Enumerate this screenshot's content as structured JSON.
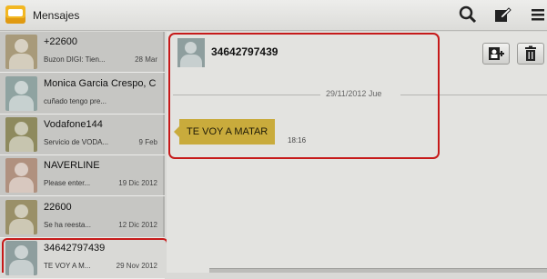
{
  "app": {
    "title": "Mensajes",
    "icon": "envelope-icon",
    "accent": "#f2b722"
  },
  "toolbar": {
    "search_icon": "search-icon",
    "compose_icon": "compose-icon",
    "menu_icon": "menu-icon"
  },
  "threads": [
    {
      "name": "+22600",
      "snippet": "Buzon DIGI: Tien...",
      "date": "28 Mar",
      "avatar_color": "#a89a7a"
    },
    {
      "name": "Monica Garcia Crespo, C",
      "snippet": "cuñado tengo pre...",
      "date": "",
      "avatar_color": "#8fa3a1"
    },
    {
      "name": "Vodafone144",
      "snippet": "Servicio de VODA...",
      "date": "9 Feb",
      "avatar_color": "#8e8a5e"
    },
    {
      "name": "NAVERLINE",
      "snippet": "Please enter...",
      "date": "19 Dic 2012",
      "avatar_color": "#b0917f"
    },
    {
      "name": "22600",
      "snippet": "Se ha reesta...",
      "date": "12 Dic 2012",
      "avatar_color": "#9a9068"
    },
    {
      "name": "34642797439",
      "snippet": "TE VOY A M...",
      "date": "29 Nov 2012",
      "avatar_color": "#8e9e9e"
    }
  ],
  "conversation": {
    "number": "34642797439",
    "date_separator": "29/11/2012 Jue",
    "message": {
      "text": "TE VOY A MATAR",
      "time": "18:16",
      "bubble_color": "#c9ab3c"
    },
    "add_contact_icon": "add-contact-icon",
    "delete_icon": "trash-icon"
  },
  "highlight_color": "#c61a1a"
}
